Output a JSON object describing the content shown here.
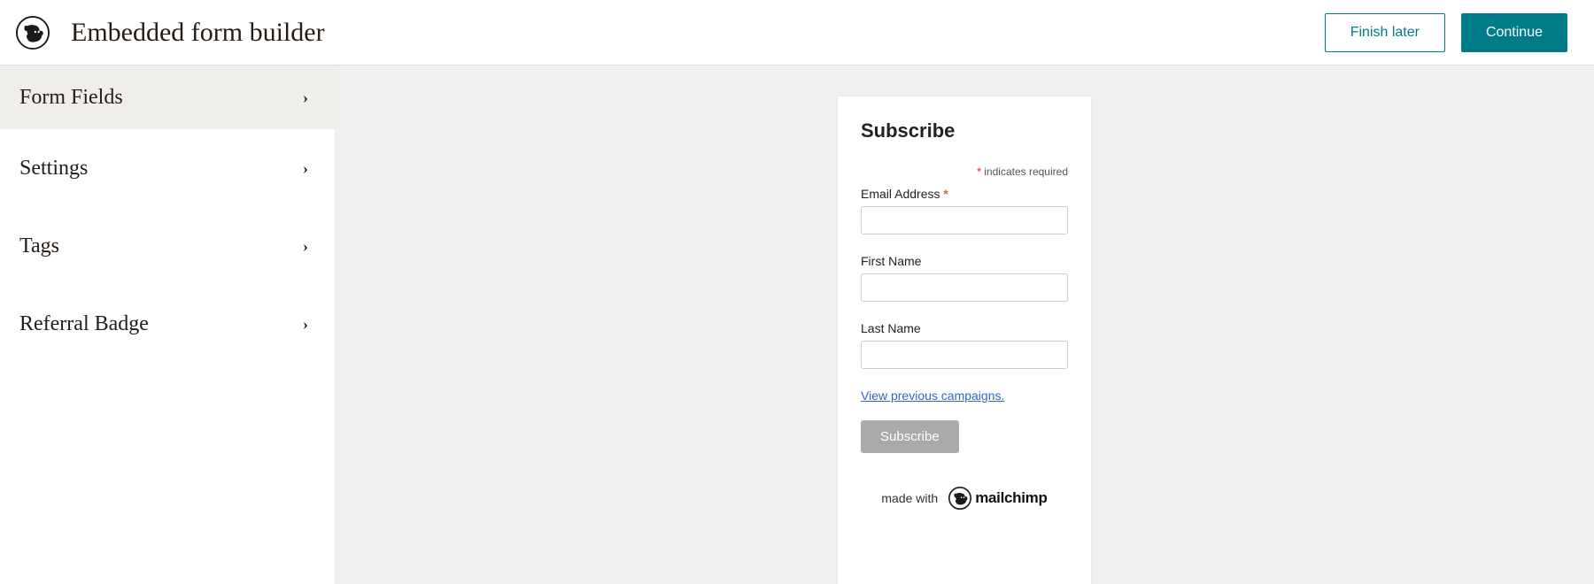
{
  "header": {
    "title": "Embedded form builder",
    "finish_later": "Finish later",
    "continue": "Continue"
  },
  "sidebar": {
    "items": [
      {
        "label": "Form Fields",
        "active": true
      },
      {
        "label": "Settings",
        "active": false
      },
      {
        "label": "Tags",
        "active": false
      },
      {
        "label": "Referral Badge",
        "active": false
      }
    ]
  },
  "form": {
    "title": "Subscribe",
    "required_text": "indicates required",
    "fields": [
      {
        "label": "Email Address",
        "required": true
      },
      {
        "label": "First Name",
        "required": false
      },
      {
        "label": "Last Name",
        "required": false
      }
    ],
    "campaigns_link": "View previous campaigns.",
    "submit_label": "Subscribe",
    "made_with": "made with",
    "brand": "mailchimp"
  }
}
